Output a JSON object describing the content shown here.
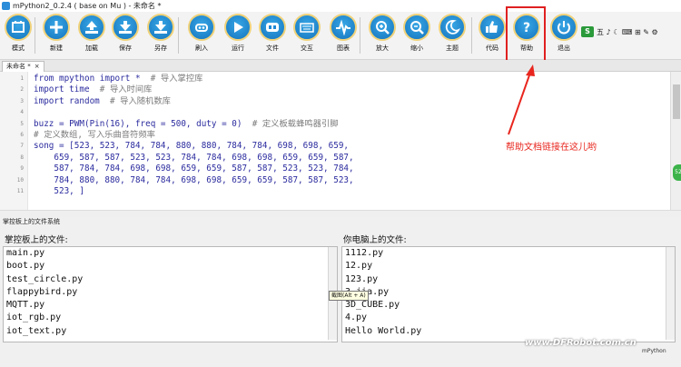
{
  "window": {
    "title": "mPython2_0.2.4 ( base on Mu ) - 未命名 *"
  },
  "toolbar": {
    "buttons": [
      {
        "id": "mode",
        "label": "模式",
        "icon": "mode-icon"
      },
      {
        "id": "new",
        "label": "新建",
        "icon": "plus-icon"
      },
      {
        "id": "load",
        "label": "加载",
        "icon": "upload-icon"
      },
      {
        "id": "save",
        "label": "保存",
        "icon": "download-icon"
      },
      {
        "id": "saveas",
        "label": "另存",
        "icon": "download-icon"
      },
      {
        "id": "flash",
        "label": "刷入",
        "icon": "flash-icon"
      },
      {
        "id": "run",
        "label": "运行",
        "icon": "play-icon"
      },
      {
        "id": "files",
        "label": "文件",
        "icon": "files-icon"
      },
      {
        "id": "repl",
        "label": "交互",
        "icon": "keyboard-icon"
      },
      {
        "id": "plotter",
        "label": "图表",
        "icon": "pulse-icon"
      },
      {
        "id": "zoomin",
        "label": "放大",
        "icon": "zoom-in-icon"
      },
      {
        "id": "zoomout",
        "label": "缩小",
        "icon": "zoom-out-icon"
      },
      {
        "id": "theme",
        "label": "主题",
        "icon": "moon-icon"
      },
      {
        "id": "check",
        "label": "代码",
        "icon": "thumbs-up-icon"
      },
      {
        "id": "help",
        "label": "帮助",
        "icon": "question-icon"
      },
      {
        "id": "quit",
        "label": "退出",
        "icon": "power-icon"
      }
    ]
  },
  "system_tray": {
    "ime_symbol": "S",
    "ime_text": "五 ♪ ☾ ⌨ ⊞ ✎ ⚙"
  },
  "tab": {
    "label": "未命名 *",
    "close": "×"
  },
  "editor": {
    "lines": [
      {
        "n": "1",
        "code": "from mpython import *",
        "comment": "  # 导入掌控库"
      },
      {
        "n": "2",
        "code": "import time",
        "comment": "  # 导入时间库"
      },
      {
        "n": "3",
        "code": "import random",
        "comment": "  # 导入随机数库"
      },
      {
        "n": "4",
        "code": "",
        "comment": ""
      },
      {
        "n": "5",
        "code": "buzz = PWM(Pin(16), freq = 500, duty = 0)",
        "comment": "  # 定义板载蜂鸣器引脚"
      },
      {
        "n": "6",
        "code": "",
        "comment": "# 定义数组, 写入乐曲音符频率"
      },
      {
        "n": "7",
        "code": "song = [523, 523, 784, 784, 880, 880, 784, 784, 698, 698, 659,",
        "comment": ""
      },
      {
        "n": "8",
        "code": "    659, 587, 587, 523, 523, 784, 784, 698, 698, 659, 659, 587,",
        "comment": ""
      },
      {
        "n": "9",
        "code": "    587, 784, 784, 698, 698, 659, 659, 587, 587, 523, 523, 784,",
        "comment": ""
      },
      {
        "n": "10",
        "code": "    784, 880, 880, 784, 784, 698, 698, 659, 659, 587, 587, 523,",
        "comment": ""
      },
      {
        "n": "11",
        "code": "    523, ]",
        "comment": ""
      }
    ],
    "side_badge": "52"
  },
  "annotation": {
    "text": "帮助文档链接在这儿哟",
    "color": "#e8261e"
  },
  "filesystem": {
    "title": "掌控板上的文件系统",
    "left_label": "掌控板上的文件:",
    "right_label": "你电脑上的文件:",
    "board_files": [
      "main.py",
      "boot.py",
      "test_circle.py",
      "flappybird.py",
      "MQTT.py",
      "iot_rgb.py",
      "iot_text.py"
    ],
    "pc_files": [
      "1112.py",
      "12.py",
      "123.py",
      "3-jia.py",
      "3D_CUBE.py",
      "4.py",
      "Hello World.py"
    ],
    "tooltip": "截图(Alt + A)"
  },
  "status": {
    "mode": "mPython"
  },
  "watermark": "www.DFRobot.com.cn",
  "colors": {
    "button_blue": "#1e88d6",
    "button_ring": "#f0d27a",
    "highlight": "#e02020"
  }
}
